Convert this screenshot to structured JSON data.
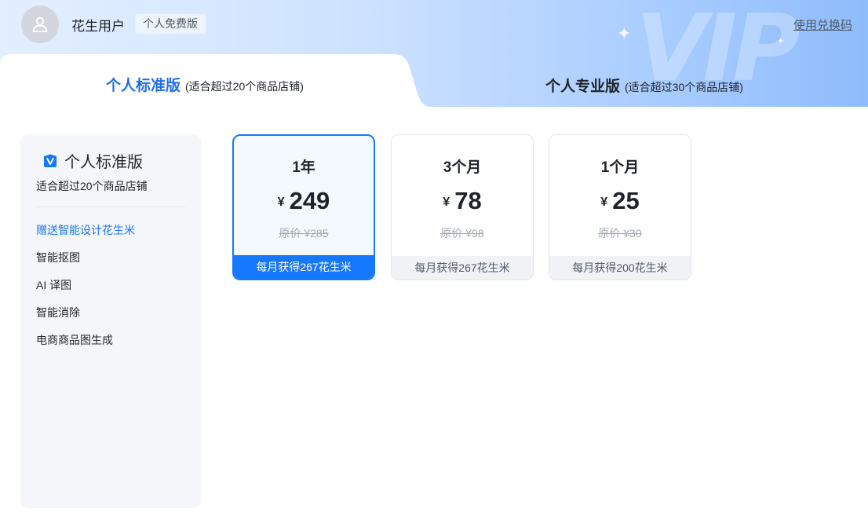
{
  "header": {
    "username": "花生用户",
    "plan_badge": "个人免费版",
    "redeem_link": "使用兑换码",
    "watermark": "VIP"
  },
  "tabs": [
    {
      "title": "个人标准版",
      "subtitle": "(适合超过20个商品店铺)",
      "active": true
    },
    {
      "title": "个人专业版",
      "subtitle": "(适合超过30个商品店铺)",
      "active": false
    }
  ],
  "sidebar": {
    "title": "个人标准版",
    "icon": "vip-shield-icon",
    "subtitle": "适合超过20个商品店铺",
    "items": [
      {
        "label": "赠送智能设计花生米",
        "accent": true
      },
      {
        "label": "智能抠图",
        "accent": false
      },
      {
        "label": "AI 译图",
        "accent": false
      },
      {
        "label": "智能消除",
        "accent": false
      },
      {
        "label": "电商商品图生成",
        "accent": false
      }
    ]
  },
  "plans": [
    {
      "duration": "1年",
      "currency": "¥",
      "price": "249",
      "original": "原价 ¥285",
      "bonus": "每月获得267花生米",
      "selected": true
    },
    {
      "duration": "3个月",
      "currency": "¥",
      "price": "78",
      "original": "原价 ¥98",
      "bonus": "每月获得267花生米",
      "selected": false
    },
    {
      "duration": "1个月",
      "currency": "¥",
      "price": "25",
      "original": "原价 ¥30",
      "bonus": "每月获得200花生米",
      "selected": false
    }
  ],
  "colors": {
    "accent": "#1677ff",
    "header_gradient_start": "#e3efff",
    "header_gradient_end": "#8fbcfb"
  }
}
